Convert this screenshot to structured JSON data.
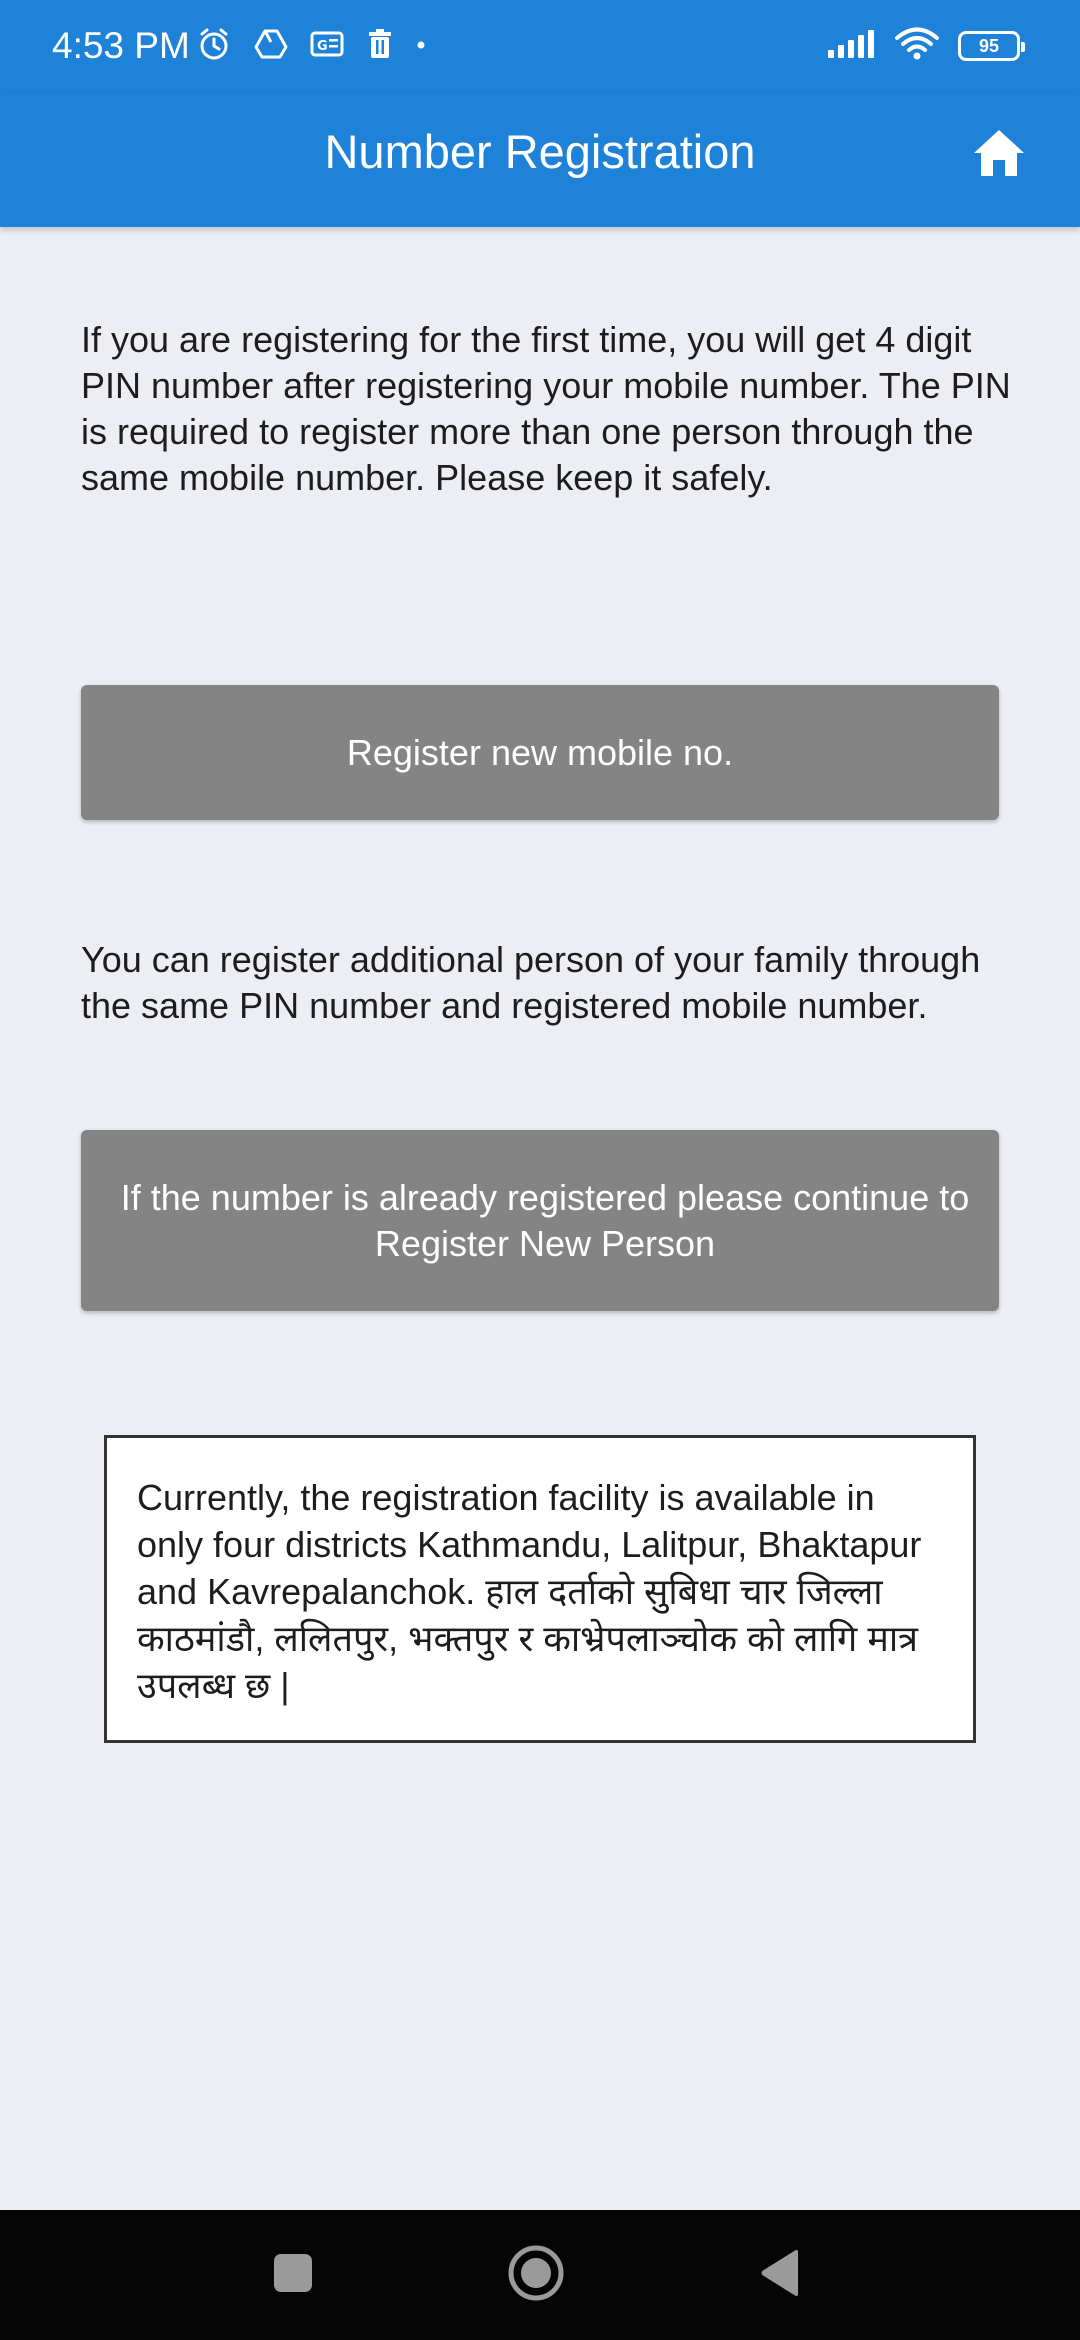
{
  "status_bar": {
    "time": "4:53 PM",
    "battery_level": "95",
    "left_icons": [
      "alarm-icon",
      "drive-icon",
      "card-icon",
      "trash-icon",
      "dot-icon"
    ],
    "right_icons": [
      "signal-icon",
      "wifi-icon",
      "battery-icon"
    ]
  },
  "app_bar": {
    "title": "Number Registration",
    "home_icon": "home-icon"
  },
  "main": {
    "intro_text": "If you are registering for the first time, you will get 4 digit PIN number after registering your mobile number. The PIN is required to register more than one person through the same mobile number. Please keep it safely.",
    "register_mobile_label": "Register new mobile no.",
    "additional_text": "You can register additional person of your family through the same PIN number and registered mobile number.",
    "register_person_label": "If the number is already registered please continue to Register New Person",
    "notice_text": "Currently, the registration facility is available in only four districts Kathmandu, Lalitpur, Bhaktapur and Kavrepalanchok. हाल दर्ताको सुबिधा चार जिल्ला काठमांडौ, ललितपुर, भक्तपुर र काभ्रेपलाञ्चोक को लागि मात्र उपलब्ध छ |"
  },
  "nav_bar": {
    "buttons": [
      "recents-icon",
      "home-circle-icon",
      "back-icon"
    ]
  },
  "colors": {
    "primary": "#1E82D9",
    "background": "#ECEEF3",
    "button": "#848484",
    "nav_bar": "#050505"
  }
}
